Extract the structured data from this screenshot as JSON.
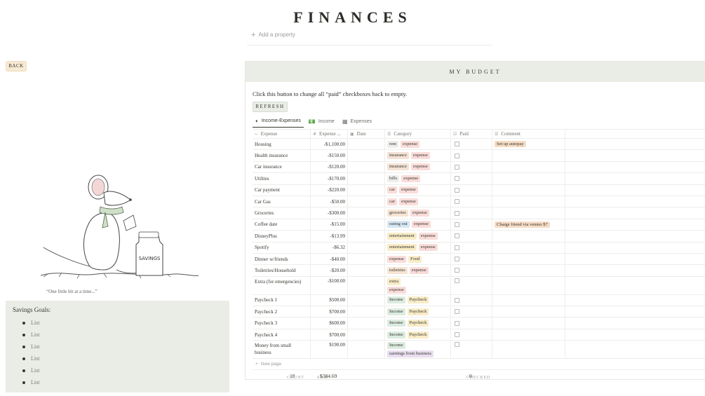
{
  "page": {
    "title": "FINANCES",
    "add_property": "Add a property",
    "back_label": "BACK",
    "quote": "“One little bit at a time...”",
    "jar_label": "SAVINGS"
  },
  "savings": {
    "heading": "Savings Goals:",
    "items": [
      "List",
      "List",
      "List",
      "List",
      "List",
      "List"
    ]
  },
  "budget": {
    "heading": "MY BUDGET",
    "instruction": "Click this button to change all “paid” checkboxes back to empty.",
    "refresh_label": "REFRESH",
    "tabs": [
      {
        "label": "Income-Expenses",
        "icon": "pie-chart-icon",
        "active": true
      },
      {
        "label": "Income",
        "icon": "money-icon",
        "active": false
      },
      {
        "label": "Expenses",
        "icon": "table-icon",
        "active": false
      }
    ],
    "columns": [
      "Expense",
      "Expense ...",
      "Date",
      "Category",
      "Paid",
      "Comment"
    ],
    "rows": [
      {
        "name": "Housing",
        "amount": "-$1,100.00",
        "tags": [
          "rent",
          "expense"
        ],
        "comment": "Set up autopay"
      },
      {
        "name": "Health insurance",
        "amount": "-$150.00",
        "tags": [
          "insurance",
          "expense"
        ],
        "comment": ""
      },
      {
        "name": "Car insurance",
        "amount": "-$120.00",
        "tags": [
          "insurance",
          "expense"
        ],
        "comment": ""
      },
      {
        "name": "Utilites",
        "amount": "-$170.00",
        "tags": [
          "bills",
          "expense"
        ],
        "comment": ""
      },
      {
        "name": "Car payment",
        "amount": "-$220.00",
        "tags": [
          "car",
          "expense"
        ],
        "comment": ""
      },
      {
        "name": "Car Gas",
        "amount": "-$50.00",
        "tags": [
          "car",
          "expense"
        ],
        "comment": ""
      },
      {
        "name": "Groceries",
        "amount": "-$300.00",
        "tags": [
          "groceries",
          "expense"
        ],
        "comment": ""
      },
      {
        "name": "Coffee date",
        "amount": "-$15.00",
        "tags": [
          "eating out",
          "expense"
        ],
        "comment": "Charge friend via venmo $7"
      },
      {
        "name": "DisneyPlus",
        "amount": "-$13.99",
        "tags": [
          "entertainment",
          "expense"
        ],
        "comment": ""
      },
      {
        "name": "Spotify",
        "amount": "-$6.32",
        "tags": [
          "entertainment",
          "expense"
        ],
        "comment": ""
      },
      {
        "name": "Dinner w/friends",
        "amount": "-$40.00",
        "tags": [
          "expense",
          "Food"
        ],
        "comment": ""
      },
      {
        "name": "Toiletries/Household",
        "amount": "-$20.00",
        "tags": [
          "toiletries",
          "expense"
        ],
        "comment": ""
      },
      {
        "name": "Extra (for emergencies)",
        "amount": "-$100.00",
        "tags": [
          "extra",
          "expense"
        ],
        "comment": ""
      },
      {
        "name": "Paycheck 1",
        "amount": "$500.00",
        "tags": [
          "Income",
          "Paycheck"
        ],
        "comment": ""
      },
      {
        "name": "Paycheck 2",
        "amount": "$700.00",
        "tags": [
          "Income",
          "Paycheck"
        ],
        "comment": ""
      },
      {
        "name": "Paycheck 3",
        "amount": "$600.00",
        "tags": [
          "Income",
          "Paycheck"
        ],
        "comment": ""
      },
      {
        "name": "Paycheck 4",
        "amount": "$700.00",
        "tags": [
          "Income",
          "Paycheck"
        ],
        "comment": ""
      },
      {
        "name": "Money from small business",
        "amount": "$190.00",
        "tags": [
          "Income",
          "earnings from business"
        ],
        "comment": ""
      }
    ],
    "new_page_label": "New page",
    "footer": {
      "count_label": "COUNT",
      "count_value": "18",
      "sum_label": "SUM",
      "sum_value": "$384.69",
      "checked_label": "CHECKED",
      "checked_value": "0"
    }
  },
  "tag_colors": {
    "rent": "t-rent",
    "expense": "t-expense",
    "insurance": "t-insurance",
    "bills": "t-bills",
    "car": "t-car",
    "groceries": "t-groceries",
    "eating out": "t-eating",
    "entertainment": "t-entertainment",
    "Food": "t-food",
    "toiletries": "t-toiletries",
    "extra": "t-extra",
    "Income": "t-income",
    "Paycheck": "t-paycheck",
    "earnings from business": "t-business"
  }
}
